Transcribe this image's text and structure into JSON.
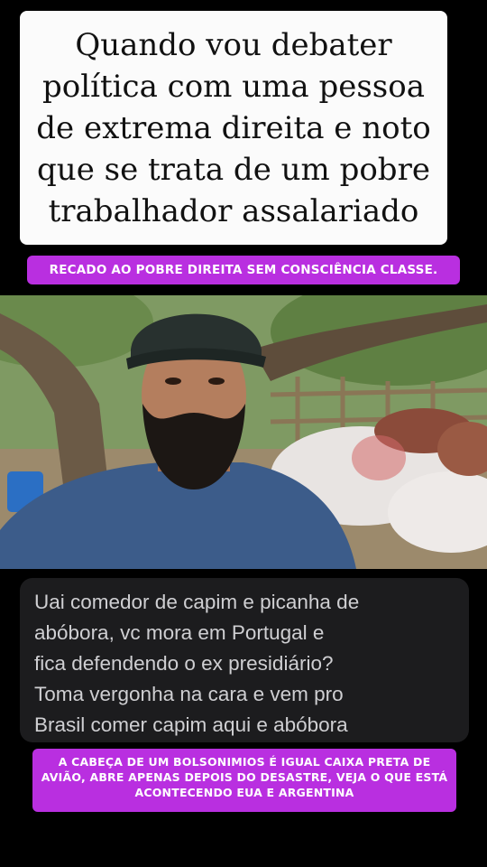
{
  "headline": {
    "text": "Quando vou debater\npolítica com uma pessoa\nde extrema direita e noto\nque se trata de um pobre\ntrabalhador assalariado"
  },
  "top_banner": {
    "text": "RECADO AO POBRE DIREITA SEM CONSCIÊNCIA CLASSE."
  },
  "comment": {
    "text": "Uai comedor de capim e picanha de\nabóbora, vc mora em Portugal e\nfica defendendo o ex presidiário?\nToma vergonha na cara e vem pro\nBrasil comer capim aqui e abóbora"
  },
  "bottom_banner": {
    "text": "A CABEÇA DE UM BOLSONIMIOS É IGUAL CAIXA PRETA DE AVIÃO, ABRE APENAS DEPOIS DO DESASTRE, VEJA O QUE ESTÁ ACONTECENDO EUA E ARGENTINA"
  },
  "colors": {
    "banner": "#b92fe0",
    "background": "#000000",
    "comment_bg": "#1c1c1e"
  }
}
